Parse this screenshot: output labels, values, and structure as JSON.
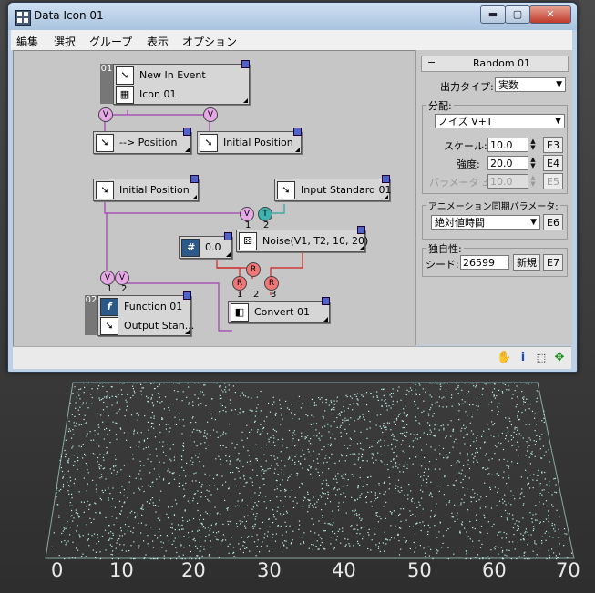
{
  "window": {
    "title": "Data Icon 01",
    "controls": {
      "minimize": "▬",
      "maximize": "▢",
      "close": "✕"
    }
  },
  "menu": [
    "編集",
    "選択",
    "グループ",
    "表示",
    "オプション"
  ],
  "graph": {
    "nodes": {
      "new_in_event": "New In Event",
      "icon01": "Icon 01",
      "to_position": "--> Position",
      "initial_position_a": "Initial Position",
      "initial_position_b": "Initial Position",
      "input_standard": "Input Standard 01",
      "noise": "Noise(V1, T2, 10, 20)",
      "constant": "0.0",
      "function01": "Function 01",
      "output_standard": "Output Stan...",
      "convert01": "Convert 01"
    },
    "group_numbers": {
      "first": "01",
      "second": "02"
    },
    "operators": {
      "v": "V",
      "t": "T",
      "r": "R"
    },
    "port_numbers": [
      "1",
      "2",
      "3"
    ]
  },
  "panel": {
    "rollout_toggle": "−",
    "rollout_title": "Random 01",
    "output_type_label": "出力タイプ:",
    "output_type_value": "実数",
    "distribution_label": "分配:",
    "distribution_value": "ノイズ V+T",
    "scale_label": "スケール:",
    "scale_value": "10.0",
    "scale_button": "E3",
    "strength_label": "強度:",
    "strength_value": "20.0",
    "strength_button": "E4",
    "param3_label": "パラメータ 3:",
    "param3_value": "10.0",
    "param3_button": "E5",
    "anim_sync_label": "アニメーション同期パラメータ:",
    "anim_sync_value": "絶対値時間",
    "anim_sync_button": "E6",
    "uniqueness_label": "独自性:",
    "seed_label": "シード:",
    "seed_value": "26599",
    "new_button": "新規",
    "seed_button": "E7"
  },
  "statusbar": {
    "icons": [
      "hand-icon",
      "info-icon",
      "region-select-icon",
      "move-icon"
    ]
  },
  "viewport": {
    "axis_labels": [
      "0",
      "10",
      "20",
      "30",
      "40",
      "50",
      "60",
      "70"
    ],
    "particle_color": "#bff5ec"
  }
}
